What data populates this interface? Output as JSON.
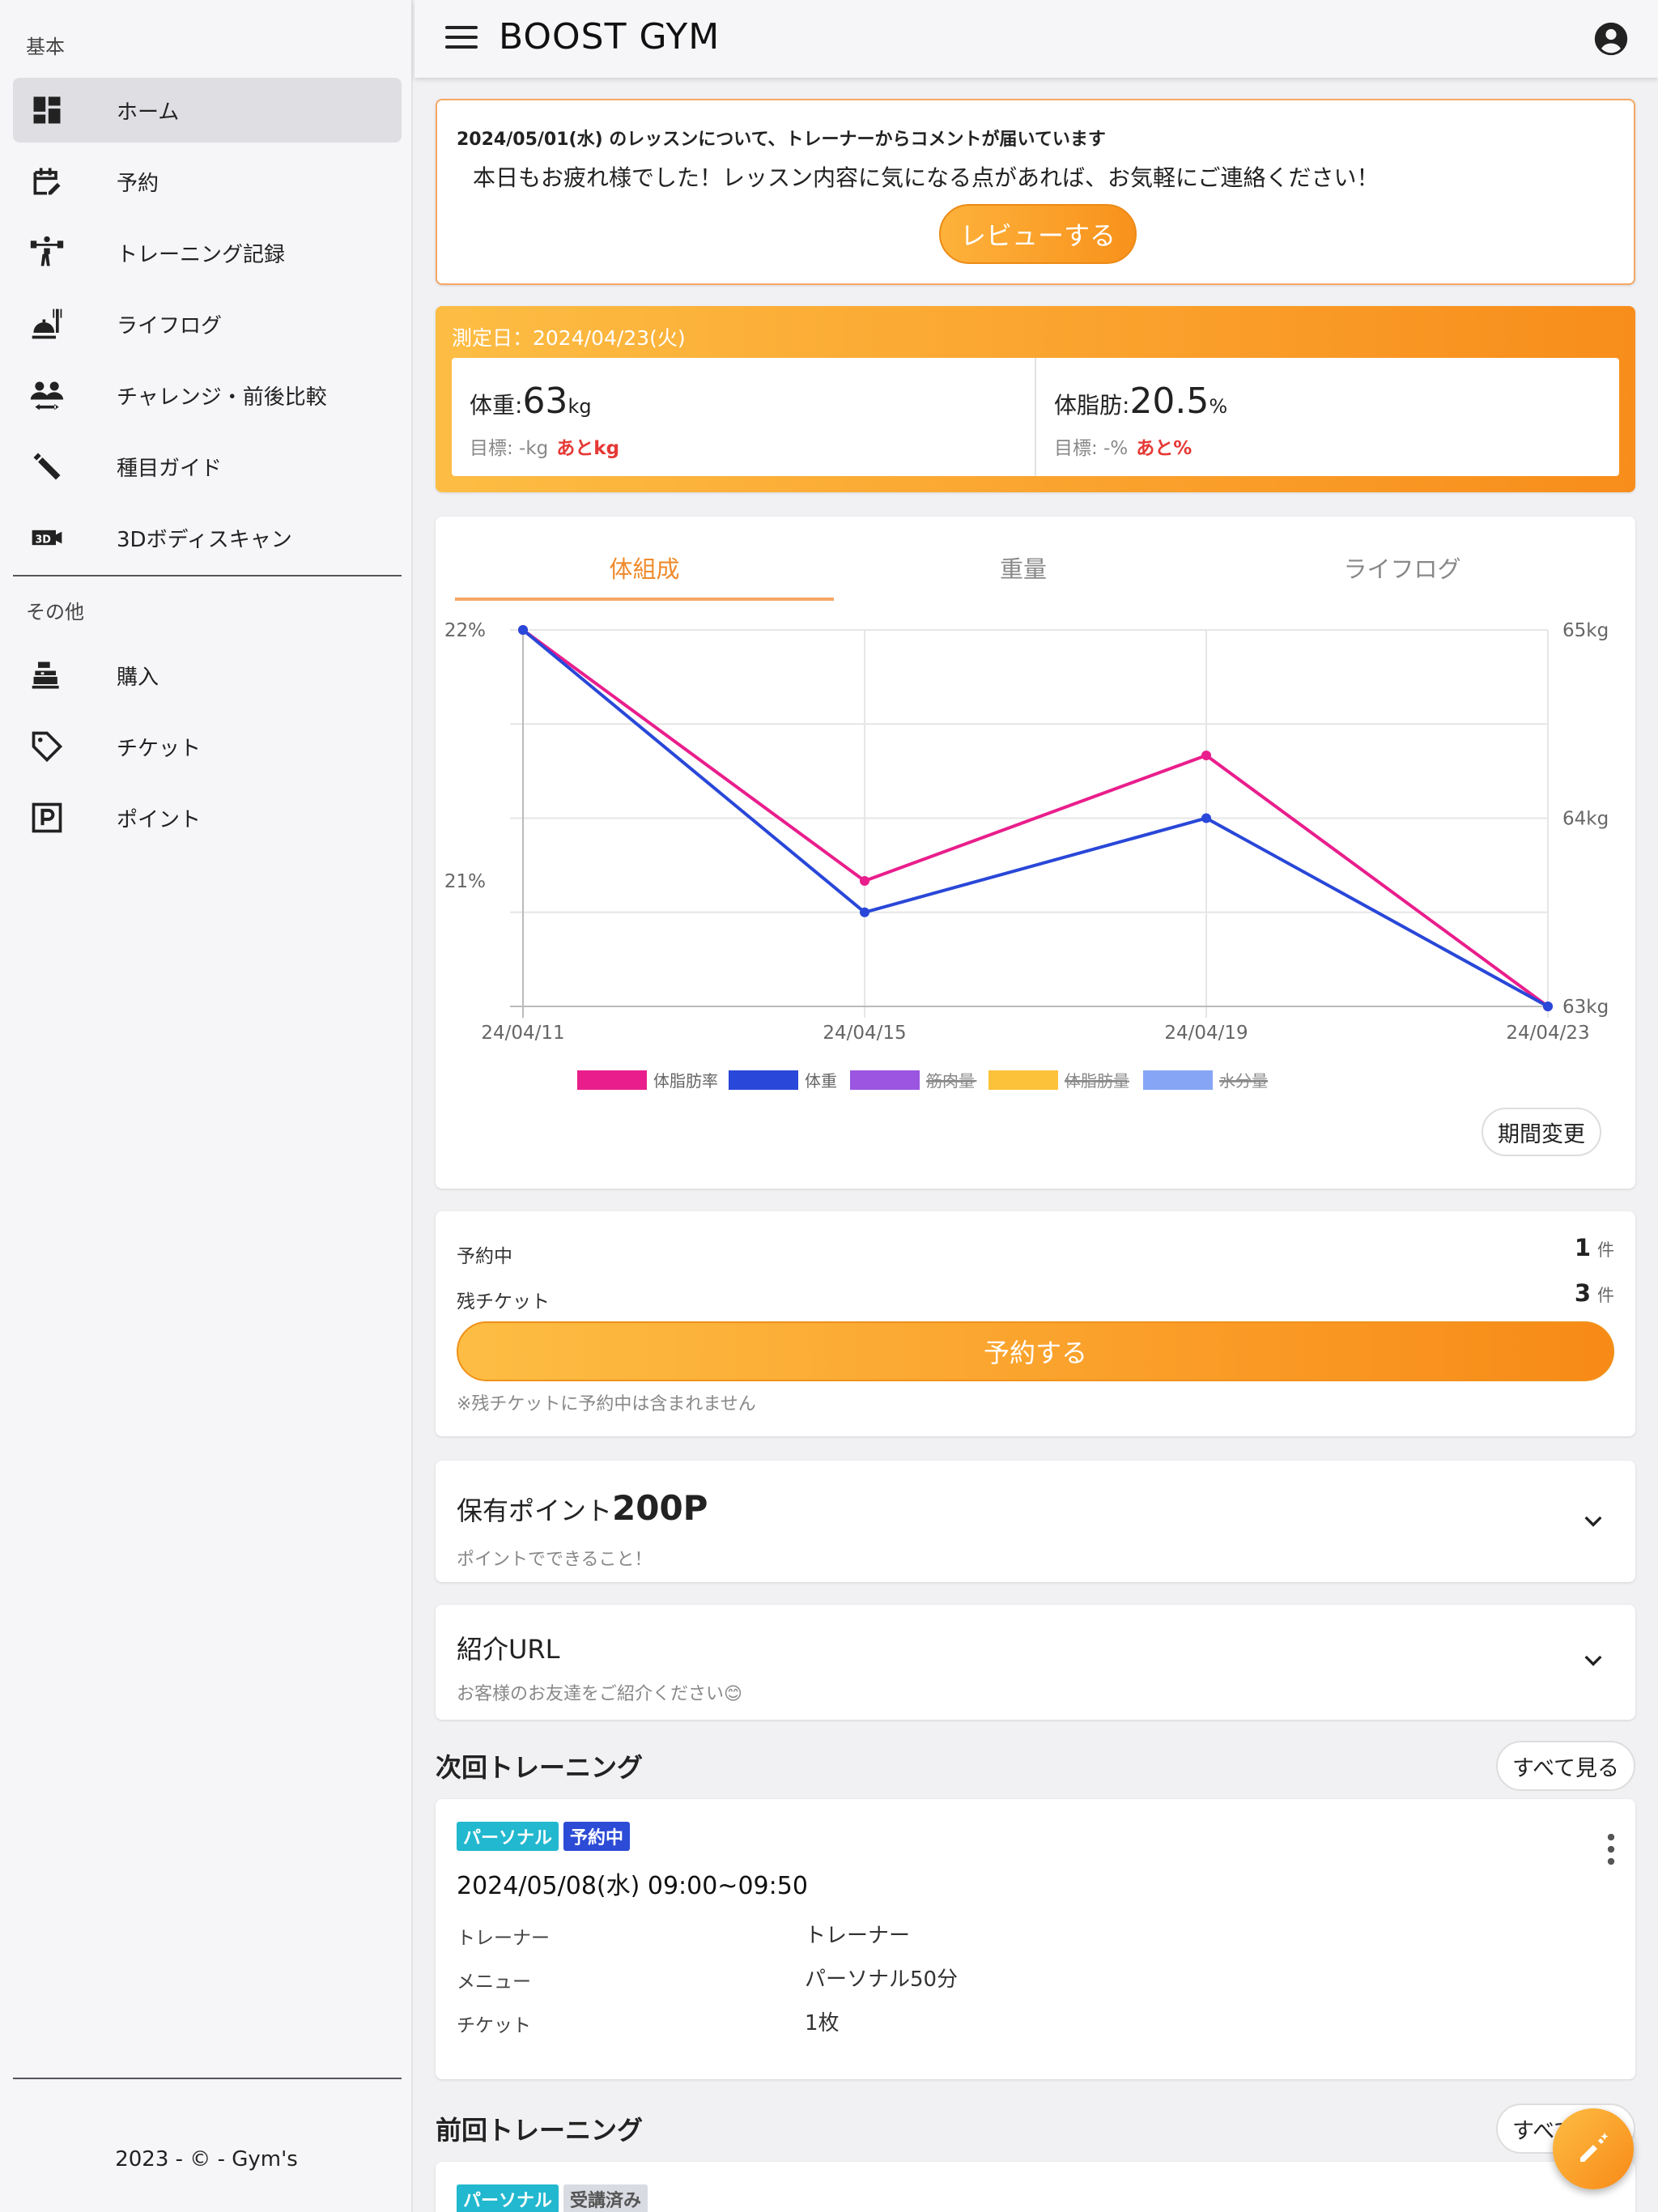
{
  "sidebar": {
    "section_basic": "基本",
    "section_other": "その他",
    "items": [
      {
        "label": "ホーム",
        "icon": "dashboard-icon"
      },
      {
        "label": "予約",
        "icon": "calendar-edit-icon"
      },
      {
        "label": "トレーニング記録",
        "icon": "weightlifting-icon"
      },
      {
        "label": "ライフログ",
        "icon": "food-icon"
      },
      {
        "label": "チャレンジ・前後比較",
        "icon": "people-icon"
      },
      {
        "label": "種目ガイド",
        "icon": "dumbbell-icon"
      },
      {
        "label": "3Dボディスキャン",
        "icon": "3d-icon"
      },
      {
        "label": "購入",
        "icon": "register-icon"
      },
      {
        "label": "チケット",
        "icon": "tag-icon"
      },
      {
        "label": "ポイント",
        "icon": "parking-p-icon"
      }
    ],
    "footer": "2023 - © - Gym's"
  },
  "header": {
    "title": "BOOST GYM"
  },
  "notice": {
    "title": "2024/05/01(水) のレッスンについて、トレーナーからコメントが届いています",
    "body": "本日もお疲れ様でした！レッスン内容に気になる点があれば、お気軽にご連絡ください！",
    "button": "レビューする"
  },
  "measurement": {
    "date_label": "測定日：2024/04/23(火)",
    "weight": {
      "label": "体重:",
      "value": "63",
      "unit": "kg",
      "target": "目標: -kg",
      "remaining": "あとkg"
    },
    "fat": {
      "label": "体脂肪:",
      "value": "20.5",
      "unit": "%",
      "target": "目標: -%",
      "remaining": "あと%"
    }
  },
  "chart_tabs": [
    "体組成",
    "重量",
    "ライフログ"
  ],
  "chart_data": {
    "type": "line",
    "categories": [
      "24/04/11",
      "24/04/15",
      "24/04/19",
      "24/04/23"
    ],
    "y_left": {
      "ticks": [
        "22%",
        "21%"
      ],
      "ylim": [
        20.5,
        22.0
      ]
    },
    "y_right": {
      "ticks": [
        "65kg",
        "64kg",
        "63kg"
      ],
      "ylim": [
        63,
        65
      ]
    },
    "series": [
      {
        "name": "体脂肪率",
        "axis": "left",
        "color": "#e91e8c",
        "values": [
          22.0,
          21.0,
          21.5,
          20.5
        ]
      },
      {
        "name": "体重",
        "axis": "right",
        "color": "#2947d8",
        "values": [
          65.0,
          63.5,
          64.0,
          63.0
        ]
      }
    ],
    "legend": [
      {
        "name": "体脂肪率",
        "color": "#e91e8c",
        "hidden": false
      },
      {
        "name": "体重",
        "color": "#2947d8",
        "hidden": false
      },
      {
        "name": "筋肉量",
        "color": "#9b55e0",
        "hidden": true
      },
      {
        "name": "体脂肪量",
        "color": "#fbc23a",
        "hidden": true
      },
      {
        "name": "水分量",
        "color": "#86a6f5",
        "hidden": true
      }
    ],
    "legend_position": "bottom",
    "grid": true
  },
  "period_button": "期間変更",
  "reserve": {
    "pending_label": "予約中",
    "pending_value": "1",
    "tickets_label": "残チケット",
    "tickets_value": "3",
    "unit": "件",
    "button": "予約する",
    "note": "※残チケットに予約中は含まれません"
  },
  "points": {
    "title": "保有ポイント",
    "value": "200P",
    "sub": "ポイントでできること！"
  },
  "referral": {
    "title": "紹介URL",
    "sub": "お客様のお友達をご紹介ください😊"
  },
  "next_training": {
    "section_title": "次回トレーニング",
    "see_all": "すべて見る",
    "badges": [
      {
        "label": "パーソナル",
        "color": "#22b8cf"
      },
      {
        "label": "予約中",
        "color": "#2c4bd6"
      }
    ],
    "datetime": "2024/05/08(水) 09:00~09:50",
    "details": [
      {
        "label": "トレーナー",
        "value": "トレーナー"
      },
      {
        "label": "メニュー",
        "value": "パーソナル50分"
      },
      {
        "label": "チケット",
        "value": "1枚"
      }
    ]
  },
  "prev_training": {
    "section_title": "前回トレーニング",
    "see_all": "すべて見る",
    "badges": [
      {
        "label": "パーソナル",
        "color": "#22b8cf"
      },
      {
        "label": "受講済み",
        "color": "#d9dbe2"
      }
    ]
  }
}
